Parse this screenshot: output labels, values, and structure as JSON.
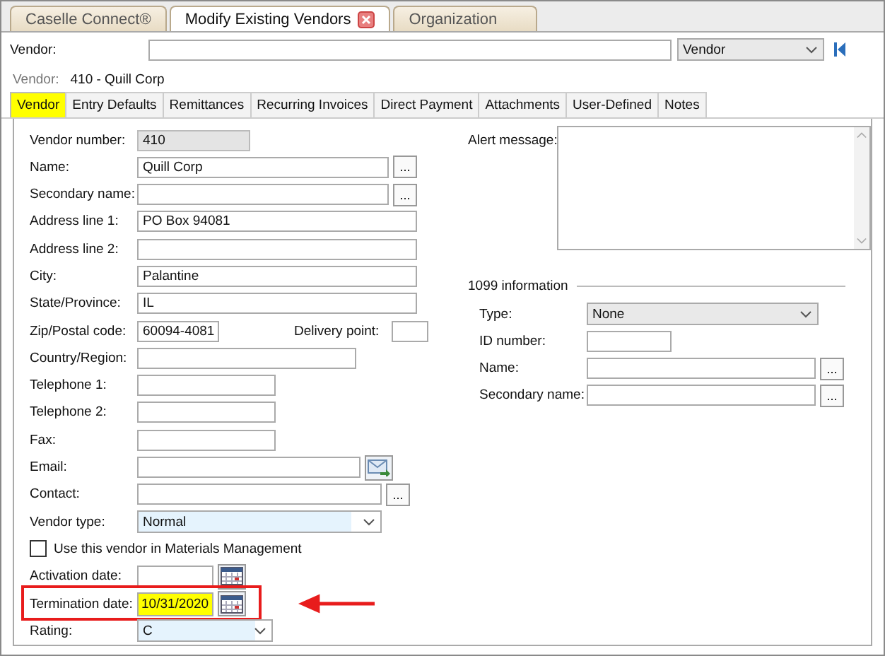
{
  "doc_tabs": [
    {
      "label": "Caselle Connect®",
      "selected": false,
      "closable": false
    },
    {
      "label": "Modify Existing Vendors",
      "selected": true,
      "closable": true
    },
    {
      "label": "Organization",
      "selected": false,
      "closable": false
    }
  ],
  "lookup": {
    "label": "Vendor:",
    "mode": "Vendor"
  },
  "current": {
    "label": "Vendor:",
    "value": "410  - Quill Corp"
  },
  "tabs": [
    {
      "label": "Vendor",
      "selected": true,
      "highlighted": true
    },
    {
      "label": "Entry Defaults",
      "selected": false,
      "highlighted": false
    },
    {
      "label": "Remittances",
      "selected": false,
      "highlighted": false
    },
    {
      "label": "Recurring Invoices",
      "selected": false,
      "highlighted": false
    },
    {
      "label": "Direct Payment",
      "selected": false,
      "highlighted": false
    },
    {
      "label": "Attachments",
      "selected": false,
      "highlighted": false
    },
    {
      "label": "User-Defined",
      "selected": false,
      "highlighted": false
    },
    {
      "label": "Notes",
      "selected": false,
      "highlighted": false
    }
  ],
  "fields": [
    {
      "kind": "text",
      "label": "Vendor number:",
      "value": "410",
      "readonly": true
    },
    {
      "kind": "text",
      "label": "Name:",
      "value": "Quill Corp",
      "button": "...",
      "readonly": false
    },
    {
      "kind": "text",
      "label": "Secondary name:",
      "button": "...",
      "readonly": false
    },
    {
      "kind": "text",
      "label": "Address line 1:",
      "value": "PO Box 94081",
      "readonly": false
    },
    {
      "kind": "text",
      "label": "Address line 2:",
      "readonly": false
    },
    {
      "kind": "text",
      "label": "City:",
      "value": "Palantine",
      "readonly": false
    },
    {
      "kind": "text",
      "label": "State/Province:",
      "value": "IL",
      "readonly": false
    },
    {
      "kind": "pair",
      "label": "Zip/Postal code:",
      "value": "60094-4081",
      "label2": "Delivery point:",
      "readonly": false
    },
    {
      "kind": "text",
      "label": "Country/Region:",
      "readonly": false
    },
    {
      "kind": "text",
      "label": "Telephone 1:",
      "readonly": false
    },
    {
      "kind": "text",
      "label": "Telephone 2:",
      "readonly": false
    },
    {
      "kind": "text",
      "label": "Fax:",
      "readonly": false
    },
    {
      "kind": "email",
      "label": "Email:",
      "readonly": false
    },
    {
      "kind": "text",
      "label": "Contact:",
      "button": "...",
      "readonly": false
    },
    {
      "kind": "select",
      "label": "Vendor type:",
      "value": "Normal"
    },
    {
      "kind": "checkbox",
      "label": "Use this vendor in Materials Management",
      "checked": false
    },
    {
      "kind": "date",
      "label": "Activation date:",
      "highlighted": false,
      "callout": false
    },
    {
      "kind": "date",
      "label": "Termination date:",
      "value": "10/31/2020",
      "highlighted": true,
      "callout": true
    },
    {
      "kind": "select",
      "label": "Rating:",
      "value": "C"
    }
  ],
  "alert": {
    "label": "Alert message:"
  },
  "info_1099": {
    "title": "1099 information",
    "fields": [
      {
        "kind": "select",
        "label": "Type:",
        "value": "None"
      },
      {
        "kind": "text",
        "label": "ID number:"
      },
      {
        "kind": "text",
        "label": "Name:",
        "button": "..."
      },
      {
        "kind": "text",
        "label": "Secondary name:",
        "button": "..."
      }
    ]
  }
}
